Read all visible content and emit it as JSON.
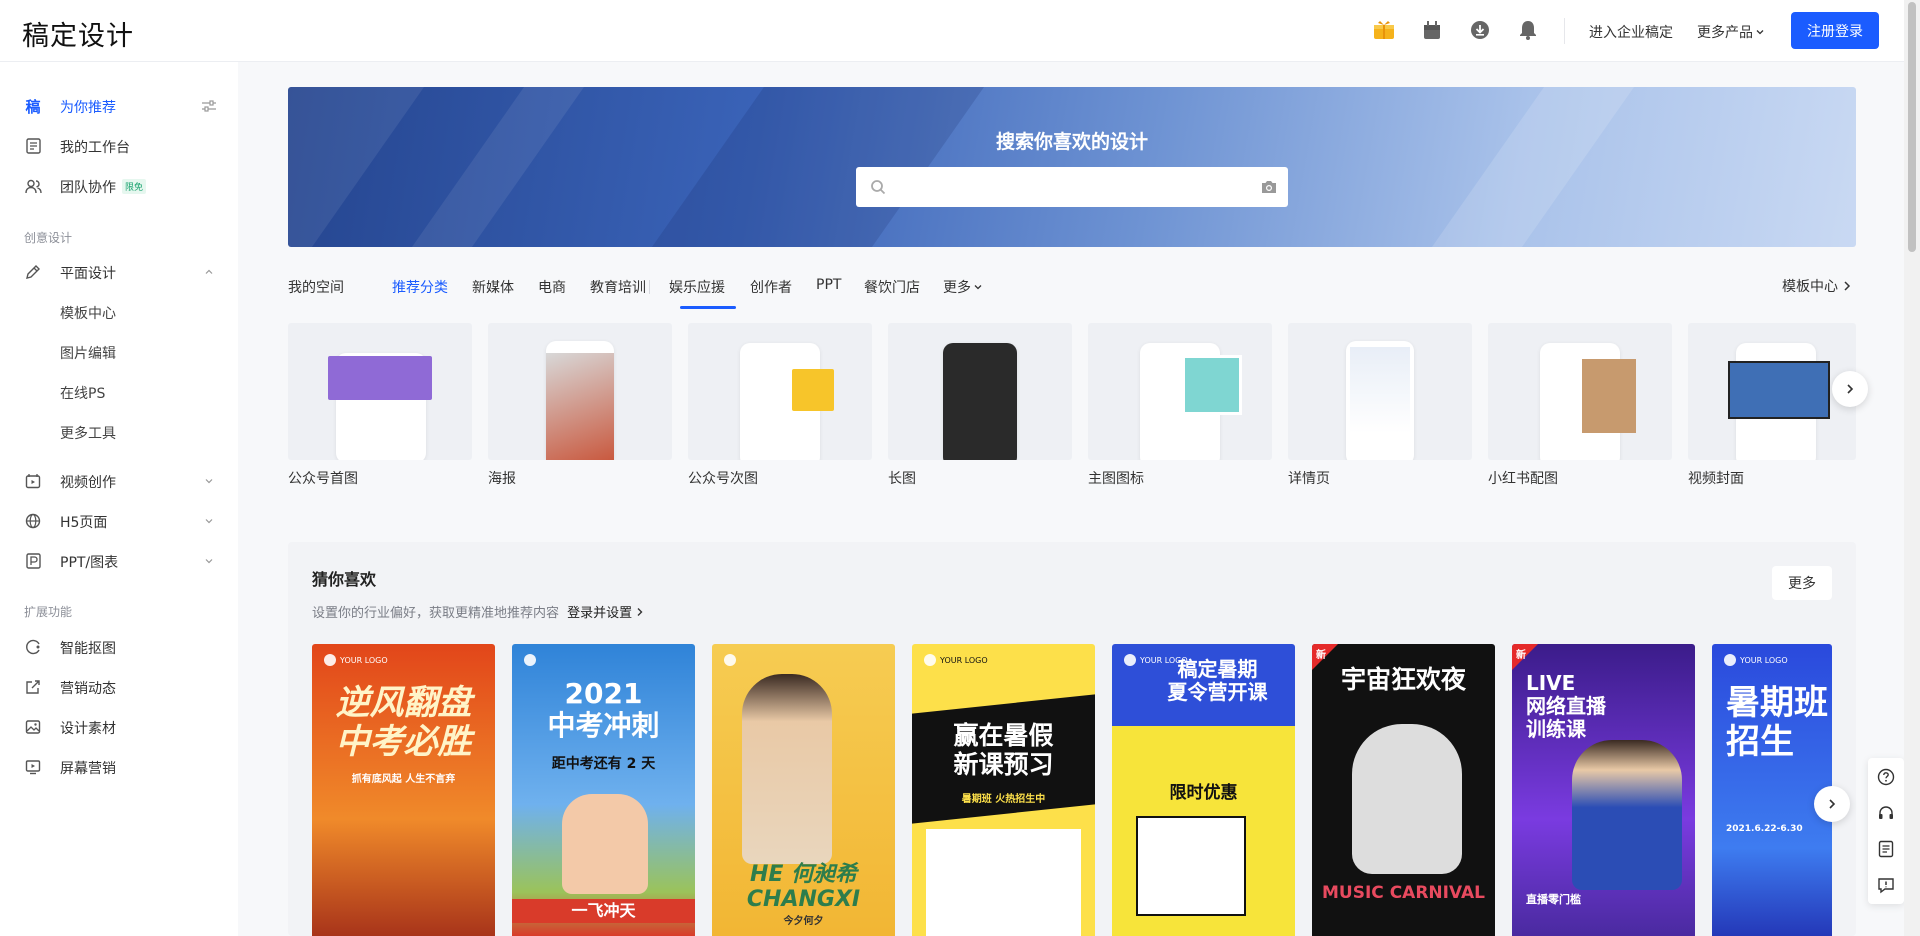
{
  "header": {
    "logo": "稿定设计",
    "icons": [
      "gift-box-icon",
      "calendar-gift-icon",
      "download-icon",
      "bell-icon"
    ],
    "enterprise_link": "进入企业稿定",
    "more_products": "更多产品",
    "register": "注册登录"
  },
  "sidebar": {
    "items": [
      {
        "label": "为你推荐",
        "icon": "gao-logo-icon"
      },
      {
        "label": "我的工作台",
        "icon": "document-icon"
      },
      {
        "label": "团队协作",
        "icon": "team-icon",
        "badge": "限免"
      }
    ],
    "group_creative": "创意设计",
    "graphic": {
      "label": "平面设计",
      "icon": "pen-icon"
    },
    "graphic_sub": [
      "模板中心",
      "图片编辑",
      "在线PS",
      "更多工具"
    ],
    "sections": [
      {
        "label": "视频创作",
        "icon": "video-icon"
      },
      {
        "label": "H5页面",
        "icon": "globe-icon"
      },
      {
        "label": "PPT/图表",
        "icon": "ppt-icon"
      }
    ],
    "group_ext": "扩展功能",
    "ext_items": [
      {
        "label": "智能抠图",
        "icon": "cutout-icon"
      },
      {
        "label": "营销动态",
        "icon": "share-icon"
      },
      {
        "label": "设计素材",
        "icon": "image-icon"
      },
      {
        "label": "屏幕营销",
        "icon": "screen-icon"
      }
    ]
  },
  "banner": {
    "title": "搜索你喜欢的设计",
    "search_placeholder": ""
  },
  "tabs": {
    "my_space": "我的空间",
    "items": [
      "推荐分类",
      "新媒体",
      "电商",
      "教育培训",
      "娱乐应援",
      "创作者",
      "PPT",
      "餐饮门店",
      "更多"
    ],
    "active": "推荐分类",
    "template_center": "模板中心"
  },
  "categories": [
    "公众号首图",
    "海报",
    "公众号次图",
    "长图",
    "主图图标",
    "详情页",
    "小红书配图",
    "视频封面"
  ],
  "guess": {
    "title": "猜你喜欢",
    "subtitle": "设置你的行业偏好，获取更精准地推荐内容",
    "subtitle_link": "登录并设置",
    "more": "更多",
    "posters": [
      {
        "logo": "YOUR LOGO",
        "text": "逆风翻盘\n中考必胜",
        "sub": "抓有底风起 人生不言弃",
        "bg": "#e85a20"
      },
      {
        "logo": "",
        "text": "2021\n中考冲刺",
        "sub": "距中考还有 2 天",
        "bottom": "一飞冲天",
        "bg": "#3c8fd6"
      },
      {
        "logo": "",
        "text": "HE 何昶希\nCHANGXI",
        "sub": "今夕何夕",
        "bg": "#f3c34a"
      },
      {
        "logo": "YOUR LOGO",
        "text": "赢在暑假\n新课预习",
        "sub": "暑期班 火热招生中",
        "bg": "#fde04a"
      },
      {
        "logo": "YOUR LOGO",
        "text": "稿定暑期\n夏令营开课",
        "sub": "限时优惠",
        "bg": "#3b5fd9"
      },
      {
        "logo": "新",
        "text": "宇宙狂欢夜",
        "sub": "MUSIC CARNIVAL",
        "bg": "#111111"
      },
      {
        "logo": "新",
        "text": "LIVE\n网络直播\n训练课",
        "sub": "直播零门槛",
        "bg": "#6b2bd6"
      },
      {
        "logo": "YOUR LOGO",
        "text": "暑期班\n招生",
        "sub": "2021.6.22-6.30",
        "bg": "#2b47d8"
      }
    ]
  },
  "float_bar": [
    "help-icon",
    "headset-icon",
    "notes-icon",
    "feedback-icon"
  ],
  "colors": {
    "accent": "#1b5cff",
    "badge_green": "#1aa36f"
  }
}
